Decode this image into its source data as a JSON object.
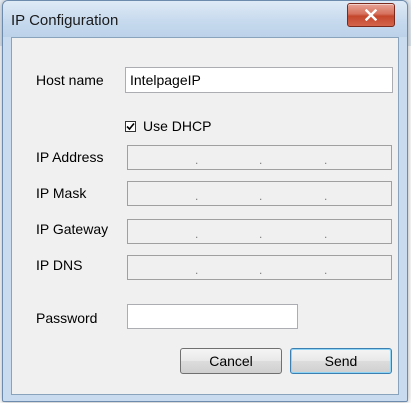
{
  "window": {
    "title": "IP Configuration",
    "close_icon": "close-icon"
  },
  "form": {
    "host_name_label": "Host name",
    "host_name_value": "IntelpageIP",
    "use_dhcp_label": "Use DHCP",
    "use_dhcp_checked": true,
    "ip_address_label": "IP Address",
    "ip_mask_label": "IP Mask",
    "ip_gateway_label": "IP Gateway",
    "ip_dns_label": "IP DNS",
    "ip_separator": ".",
    "password_label": "Password",
    "password_value": ""
  },
  "buttons": {
    "cancel_label": "Cancel",
    "send_label": "Send"
  },
  "colors": {
    "titlebar": "#c9dcef",
    "close_button": "#c4472c",
    "dialog_bg": "#f0f0f0"
  }
}
